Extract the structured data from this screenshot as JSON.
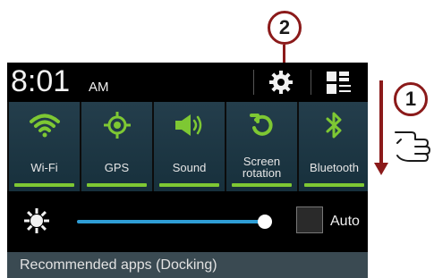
{
  "callouts": {
    "step1": "1",
    "step2": "2"
  },
  "status_bar": {
    "time": "8:01",
    "ampm": "AM",
    "settings_icon": "gear-icon",
    "grid_icon": "quick-settings-grid-icon"
  },
  "toggles": [
    {
      "label": "Wi-Fi",
      "icon": "wifi-icon",
      "color": "#7ec833"
    },
    {
      "label": "GPS",
      "icon": "gps-icon",
      "color": "#7ec833"
    },
    {
      "label": "Sound",
      "icon": "sound-icon",
      "color": "#7ec833"
    },
    {
      "label_line1": "Screen",
      "label_line2": "rotation",
      "icon": "screen-rotation-icon",
      "color": "#7ec833"
    },
    {
      "label": "Bluetooth",
      "icon": "bluetooth-icon",
      "color": "#7ec833"
    }
  ],
  "brightness": {
    "level_fraction": 1.0,
    "auto_label": "Auto",
    "auto_checked": false
  },
  "recommended": {
    "text": "Recommended apps (Docking)"
  },
  "colors": {
    "accent": "#7ec833",
    "slider": "#2f9ed6",
    "callout": "#8b1a1a"
  }
}
